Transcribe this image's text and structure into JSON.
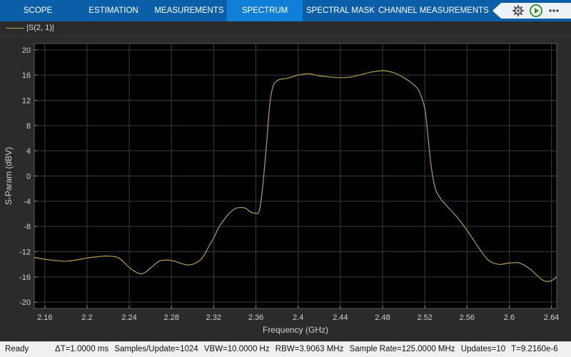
{
  "toolstrip": {
    "tabs": [
      {
        "label": "SCOPE",
        "active": false
      },
      {
        "label": "ESTIMATION",
        "active": false
      },
      {
        "label": "MEASUREMENTS",
        "active": false
      },
      {
        "label": "SPECTRUM",
        "active": true
      },
      {
        "label": "SPECTRAL MASK",
        "active": false
      },
      {
        "label": "CHANNEL MEASUREMENTS",
        "active": false
      }
    ],
    "quick_access": [
      "settings-gear-icon",
      "run-icon",
      "more-options-icon"
    ]
  },
  "legend": {
    "label": "|S(2, 1)|",
    "color": "#b29d52"
  },
  "chart_data": {
    "type": "line",
    "xlabel": "Frequency (GHz)",
    "ylabel": "S-Param (dBV)",
    "xlim": [
      2.15,
      2.645
    ],
    "ylim": [
      -21,
      21
    ],
    "xticks": [
      2.16,
      2.2,
      2.24,
      2.28,
      2.32,
      2.36,
      2.4,
      2.44,
      2.48,
      2.52,
      2.56,
      2.6,
      2.64
    ],
    "xtick_labels": [
      "2.16",
      "2.2",
      "2.24",
      "2.28",
      "2.32",
      "2.36",
      "2.4",
      "2.44",
      "2.48",
      "2.52",
      "2.56",
      "2.6",
      "2.64"
    ],
    "yticks": [
      20,
      16,
      12,
      8,
      4,
      0,
      -4,
      -8,
      -12,
      -16,
      -20
    ],
    "ytick_labels": [
      "20",
      "16",
      "12",
      "8",
      "4",
      "0",
      "-4",
      "-8",
      "-12",
      "-16",
      "-20"
    ],
    "grid": true,
    "background": "#000000",
    "series": [
      {
        "name": "|S(2, 1)|",
        "color": "#b29d52",
        "x": [
          2.15,
          2.16,
          2.17,
          2.18,
          2.19,
          2.2,
          2.21,
          2.22,
          2.23,
          2.24,
          2.245,
          2.25,
          2.255,
          2.26,
          2.265,
          2.27,
          2.28,
          2.29,
          2.295,
          2.3,
          2.305,
          2.31,
          2.315,
          2.32,
          2.325,
          2.33,
          2.335,
          2.34,
          2.345,
          2.35,
          2.355,
          2.36,
          2.363,
          2.366,
          2.37,
          2.373,
          2.376,
          2.38,
          2.385,
          2.39,
          2.4,
          2.41,
          2.42,
          2.43,
          2.44,
          2.45,
          2.46,
          2.47,
          2.48,
          2.49,
          2.5,
          2.51,
          2.515,
          2.52,
          2.523,
          2.526,
          2.53,
          2.535,
          2.54,
          2.55,
          2.56,
          2.57,
          2.58,
          2.59,
          2.6,
          2.61,
          2.62,
          2.63,
          2.635,
          2.64,
          2.645
        ],
        "y": [
          -12.9,
          -13.2,
          -13.4,
          -13.5,
          -13.3,
          -13.0,
          -12.8,
          -12.7,
          -13.0,
          -14.5,
          -15.1,
          -15.5,
          -15.3,
          -14.6,
          -13.9,
          -13.4,
          -13.4,
          -13.9,
          -14.1,
          -14.0,
          -13.6,
          -12.8,
          -11.3,
          -9.8,
          -8.1,
          -6.9,
          -5.9,
          -5.2,
          -5.0,
          -5.1,
          -5.7,
          -5.9,
          -5.6,
          -2.4,
          4.9,
          11.2,
          14.1,
          15.1,
          15.4,
          15.5,
          16.0,
          16.2,
          15.9,
          15.7,
          15.6,
          15.7,
          16.1,
          16.5,
          16.7,
          16.4,
          15.6,
          14.4,
          13.3,
          10.7,
          6.3,
          1.6,
          -2.0,
          -3.6,
          -4.6,
          -6.4,
          -8.6,
          -11.1,
          -13.3,
          -14.0,
          -13.8,
          -13.8,
          -14.8,
          -16.3,
          -16.7,
          -16.6,
          -16.0
        ]
      }
    ]
  },
  "status": {
    "ready": "Ready",
    "items": [
      "ΔT=1.0000 ms",
      "Samples/Update=1024",
      "VBW=10.0000 Hz",
      "RBW=3.9063 MHz",
      "Sample Rate=125.0000 MHz",
      "Updates=10",
      "T=9.2160e-6"
    ]
  }
}
